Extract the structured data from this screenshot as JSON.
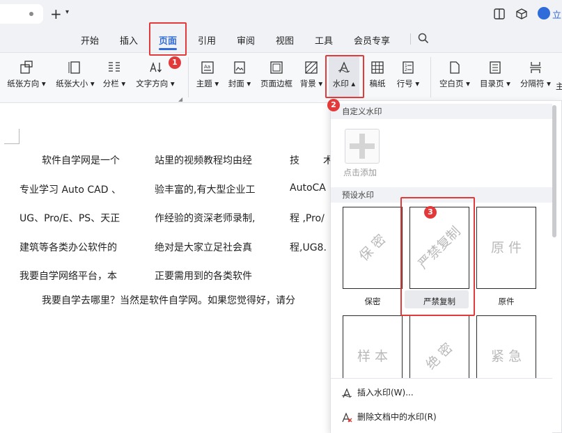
{
  "titlebar": {
    "user_label": "立"
  },
  "menu": {
    "tabs": [
      {
        "label": "开始"
      },
      {
        "label": "插入"
      },
      {
        "label": "页面"
      },
      {
        "label": "引用"
      },
      {
        "label": "审阅"
      },
      {
        "label": "视图"
      },
      {
        "label": "工具"
      },
      {
        "label": "会员专享"
      }
    ]
  },
  "ribbon": {
    "buttons": [
      {
        "label": "纸张方向 ▾"
      },
      {
        "label": "纸张大小 ▾"
      },
      {
        "label": "分栏 ▾"
      },
      {
        "label": "文字方向 ▾"
      },
      {
        "label": "主题 ▾"
      },
      {
        "label": "封面 ▾"
      },
      {
        "label": "页面边框"
      },
      {
        "label": "背景 ▾"
      },
      {
        "label": "水印 ▴"
      },
      {
        "label": "稿纸"
      },
      {
        "label": "行号 ▾"
      },
      {
        "label": "空白页 ▾"
      },
      {
        "label": "目录页 ▾"
      },
      {
        "label": "分隔符 ▾"
      },
      {
        "label": "主"
      }
    ]
  },
  "badges": [
    "1",
    "2",
    "3"
  ],
  "document": {
    "lines": [
      [
        "软件自学网是一个",
        "站里的视频教程均由经",
        "技",
        "术"
      ],
      [
        "专业学习 Auto CAD 、",
        "验丰富的,有大型企业工",
        "AutoCA"
      ],
      [
        "UG、Pro/E、PS、天正",
        "作经验的资深老师录制,",
        "程 ,Pro/"
      ],
      [
        "建筑等各类办公软件的",
        "绝对是大家立足社会真",
        "程,UG8."
      ],
      [
        "我要自学网络平台，本",
        "正要需用到的各类软件"
      ],
      [
        "我要自学去哪里？当然是软件自学网。如果您觉得好，请分"
      ]
    ]
  },
  "dropdown": {
    "custom_header": "自定义水印",
    "add_label": "点击添加",
    "preset_header": "预设水印",
    "watermarks": [
      {
        "text": "保 密",
        "label": "保密"
      },
      {
        "text": "严禁复制",
        "label": "严禁复制"
      },
      {
        "text": "原 件",
        "label": "原件"
      },
      {
        "text": "样 本",
        "label": ""
      },
      {
        "text": "绝 密",
        "label": ""
      },
      {
        "text": "紧 急",
        "label": ""
      }
    ],
    "insert_label": "插入水印(W)...",
    "delete_label": "删除文档中的水印(R)"
  }
}
